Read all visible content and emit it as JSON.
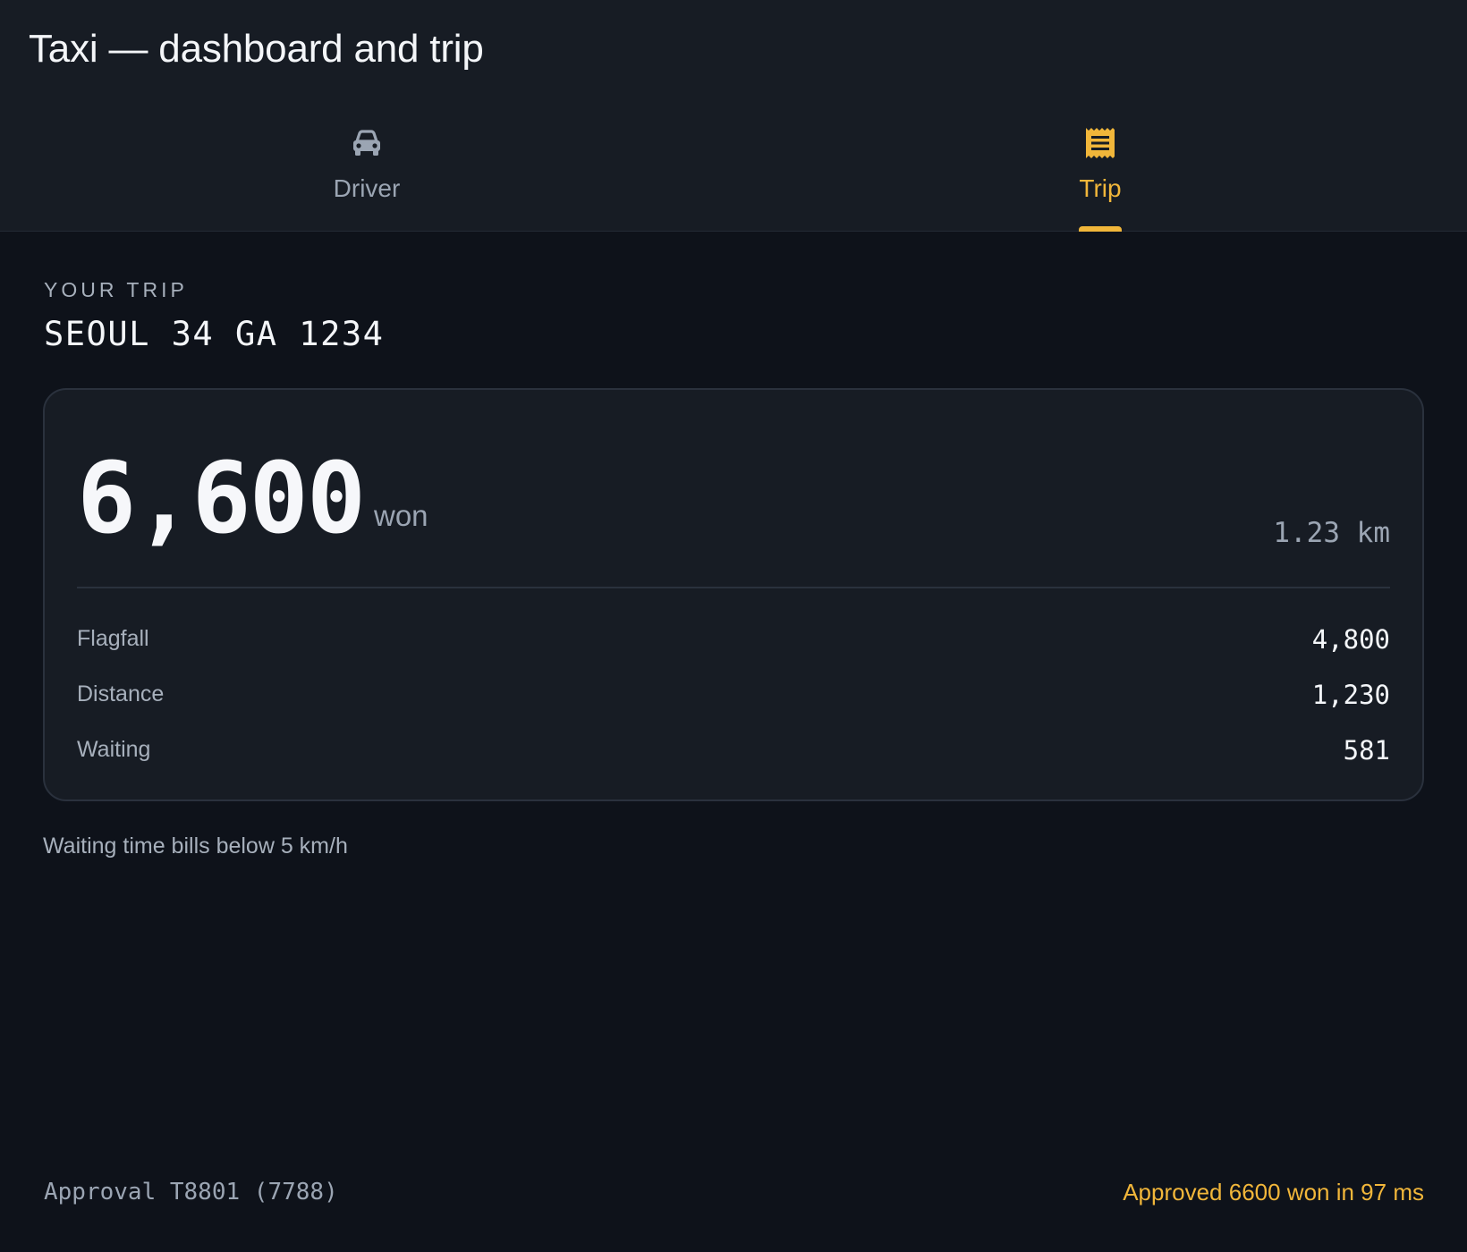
{
  "app": {
    "title": "Taxi — dashboard and trip"
  },
  "tabs": [
    {
      "label": "Driver",
      "icon": "car-icon",
      "active": false
    },
    {
      "label": "Trip",
      "icon": "receipt-icon",
      "active": true
    }
  ],
  "trip": {
    "eyebrow": "YOUR TRIP",
    "plate": "SEOUL 34 GA 1234"
  },
  "fare": {
    "amount": "6,600",
    "unit": "won",
    "distance": "1.23 km",
    "breakdown": [
      {
        "label": "Flagfall",
        "value": "4,800"
      },
      {
        "label": "Distance",
        "value": "1,230"
      },
      {
        "label": "Waiting",
        "value": "581"
      }
    ]
  },
  "note": "Waiting time bills below 5 km/h",
  "footer": {
    "approval_code": "Approval T8801 (7788)",
    "approval_status": "Approved 6600 won in 97 ms"
  },
  "colors": {
    "background": "#0e121a",
    "surface": "#171c24",
    "accent": "#f1b63a",
    "muted": "#9ba5b3",
    "text": "#f4f6f9"
  }
}
